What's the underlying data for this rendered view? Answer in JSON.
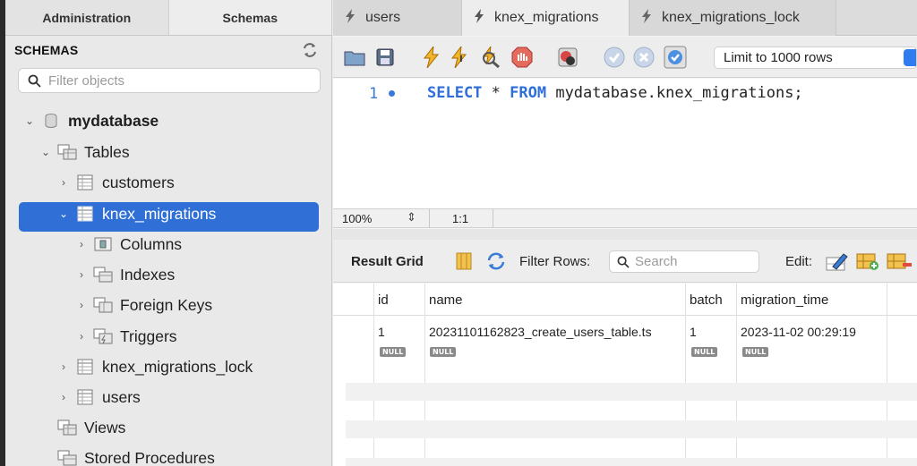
{
  "left_panel": {
    "tabs": [
      "Administration",
      "Schemas"
    ],
    "header": "SCHEMAS",
    "filter_placeholder": "Filter objects",
    "tree": [
      {
        "label": "mydatabase",
        "bold": true
      },
      {
        "label": "Tables"
      },
      {
        "label": "customers"
      },
      {
        "label": "knex_migrations",
        "selected": true
      },
      {
        "label": "Columns"
      },
      {
        "label": "Indexes"
      },
      {
        "label": "Foreign Keys"
      },
      {
        "label": "Triggers"
      },
      {
        "label": "knex_migrations_lock"
      },
      {
        "label": "users"
      },
      {
        "label": "Views"
      },
      {
        "label": "Stored Procedures"
      }
    ]
  },
  "editor_tabs": [
    "users",
    "knex_migrations",
    "knex_migrations_lock"
  ],
  "toolbar": {
    "limit_label": "Limit to 1000 rows",
    "icons": [
      "open-file-icon",
      "save-icon",
      "execute-icon",
      "execute-current-icon",
      "explain-icon",
      "stop-icon",
      "toggle-error-icon",
      "commit-icon",
      "rollback-icon",
      "autocommit-icon"
    ]
  },
  "editor": {
    "line_number": "1",
    "keywords": [
      "SELECT",
      "FROM"
    ],
    "star": " * ",
    "table": " mydatabase.knex_migrations;"
  },
  "status": {
    "zoom": "100%",
    "position": "1:1"
  },
  "result": {
    "label": "Result Grid",
    "filter_label": "Filter Rows:",
    "search_placeholder": "Search",
    "edit_label": "Edit:",
    "columns": [
      "id",
      "name",
      "batch",
      "migration_time"
    ],
    "rows": [
      [
        "1",
        "20231101162823_create_users_table.ts",
        "1",
        "2023-11-02 00:29:19"
      ]
    ],
    "null_label": "NULL"
  },
  "colors": {
    "selection": "#2f6fd6",
    "keyword": "#2d6ed9"
  }
}
